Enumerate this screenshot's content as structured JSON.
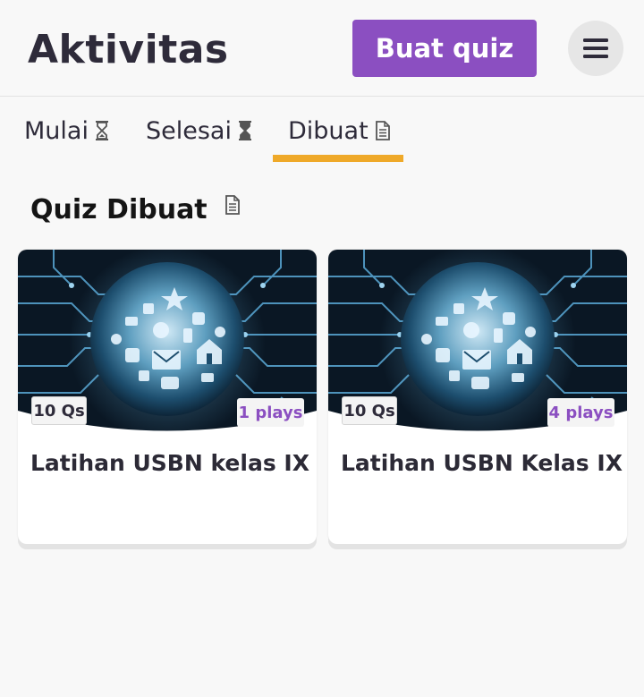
{
  "header": {
    "title": "Aktivitas",
    "create_label": "Buat quiz",
    "menu_icon": "hamburger-menu-icon"
  },
  "tabs": [
    {
      "label": "Mulai",
      "icon": "hourglass-icon",
      "active": false
    },
    {
      "label": "Selesai",
      "icon": "hourglass-icon",
      "active": false
    },
    {
      "label": "Dibuat",
      "icon": "document-icon",
      "active": true
    }
  ],
  "section": {
    "title": "Quiz Dibuat",
    "icon": "document-icon"
  },
  "quizzes": [
    {
      "title": "Latihan USBN kelas IX",
      "questions": "10 Qs",
      "plays": "1 plays",
      "image": "globe-circuit-thumbnail"
    },
    {
      "title": "Latihan USBN Kelas IX",
      "questions": "10 Qs",
      "plays": "4 plays",
      "image": "globe-circuit-thumbnail"
    }
  ],
  "colors": {
    "accent_purple": "#8b4fc1",
    "tab_indicator": "#efa929",
    "background": "#f8f8f8",
    "text_dark": "#2e2b3a"
  }
}
